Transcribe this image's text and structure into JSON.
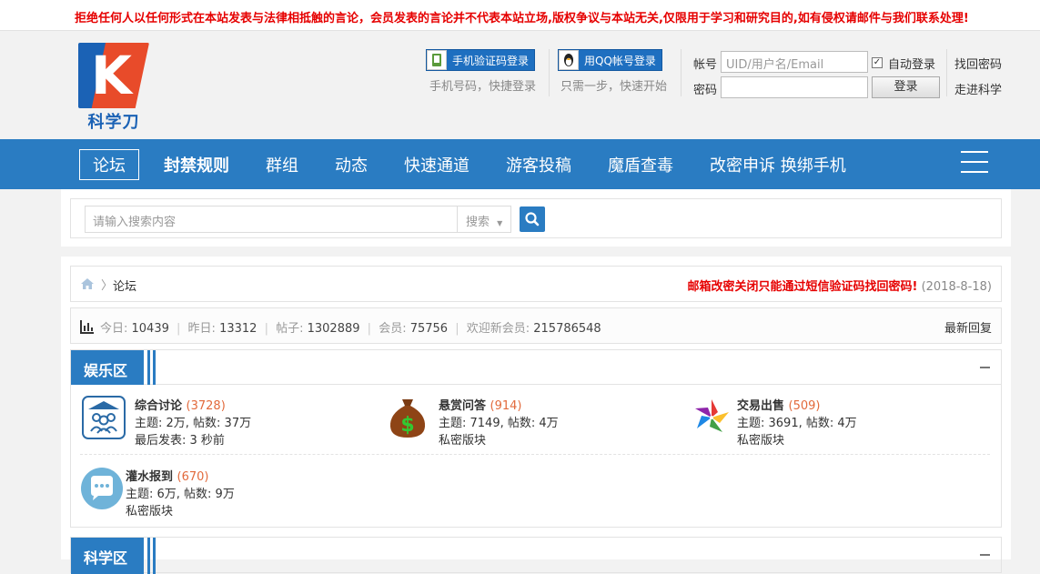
{
  "notice": "拒绝任何人以任何形式在本站发表与法律相抵触的言论，会员发表的言论并不代表本站立场,版权争议与本站无关,仅限用于学习和研究目的,如有侵权请邮件与我们联系处理!",
  "logo": {
    "letter": "K",
    "name": "科学刀"
  },
  "login": {
    "phone_button": "手机验证码登录",
    "phone_hint": "手机号码，快捷登录",
    "qq_button": "用QQ帐号登录",
    "qq_hint": "只需一步，快速开始",
    "account_label": "帐号",
    "account_placeholder": "UID/用户名/Email",
    "auto_login": "自动登录",
    "forgot": "找回密码",
    "password_label": "密码",
    "login_button": "登录",
    "register": "走进科学"
  },
  "nav": {
    "items": [
      "论坛",
      "封禁规则",
      "群组",
      "动态",
      "快速通道",
      "游客投稿",
      "魔盾查毒",
      "改密申诉 换绑手机"
    ]
  },
  "search": {
    "placeholder": "请输入搜索内容",
    "type": "搜索"
  },
  "breadcrumb": {
    "current": "论坛",
    "sep": "〉",
    "alert": "邮箱改密关闭只能通过短信验证码找回密码!",
    "alert_date": "(2018-8-18)"
  },
  "stats": {
    "today_label": "今日: ",
    "today": "10439",
    "yesterday_label": "昨日: ",
    "yesterday": "13312",
    "posts_label": "帖子: ",
    "posts": "1302889",
    "members_label": "会员: ",
    "members": "75756",
    "newest_label": "欢迎新会员: ",
    "newest": "215786548",
    "sep": "|",
    "latest": "最新回复"
  },
  "section": {
    "title": "娱乐区",
    "forums": [
      {
        "name": "综合讨论",
        "count": "(3728)",
        "line1": "主题: 2万, 帖数: 37万",
        "line2": "最后发表: 3 秒前"
      },
      {
        "name": "悬赏问答",
        "count": "(914)",
        "line1": "主题: 7149, 帖数: 4万",
        "line2": "私密版块"
      },
      {
        "name": "交易出售",
        "count": "(509)",
        "line1": "主题: 3691, 帖数: 4万",
        "line2": "私密版块"
      },
      {
        "name": "灌水报到",
        "count": "(670)",
        "line1": "主题: 6万, 帖数: 9万",
        "line2": "私密版块"
      }
    ]
  },
  "section2": {
    "title": "科学区"
  },
  "colors": {
    "brand_blue": "#2a7cc2",
    "warning_red": "#e60000",
    "count_orange": "#e26a3c"
  }
}
